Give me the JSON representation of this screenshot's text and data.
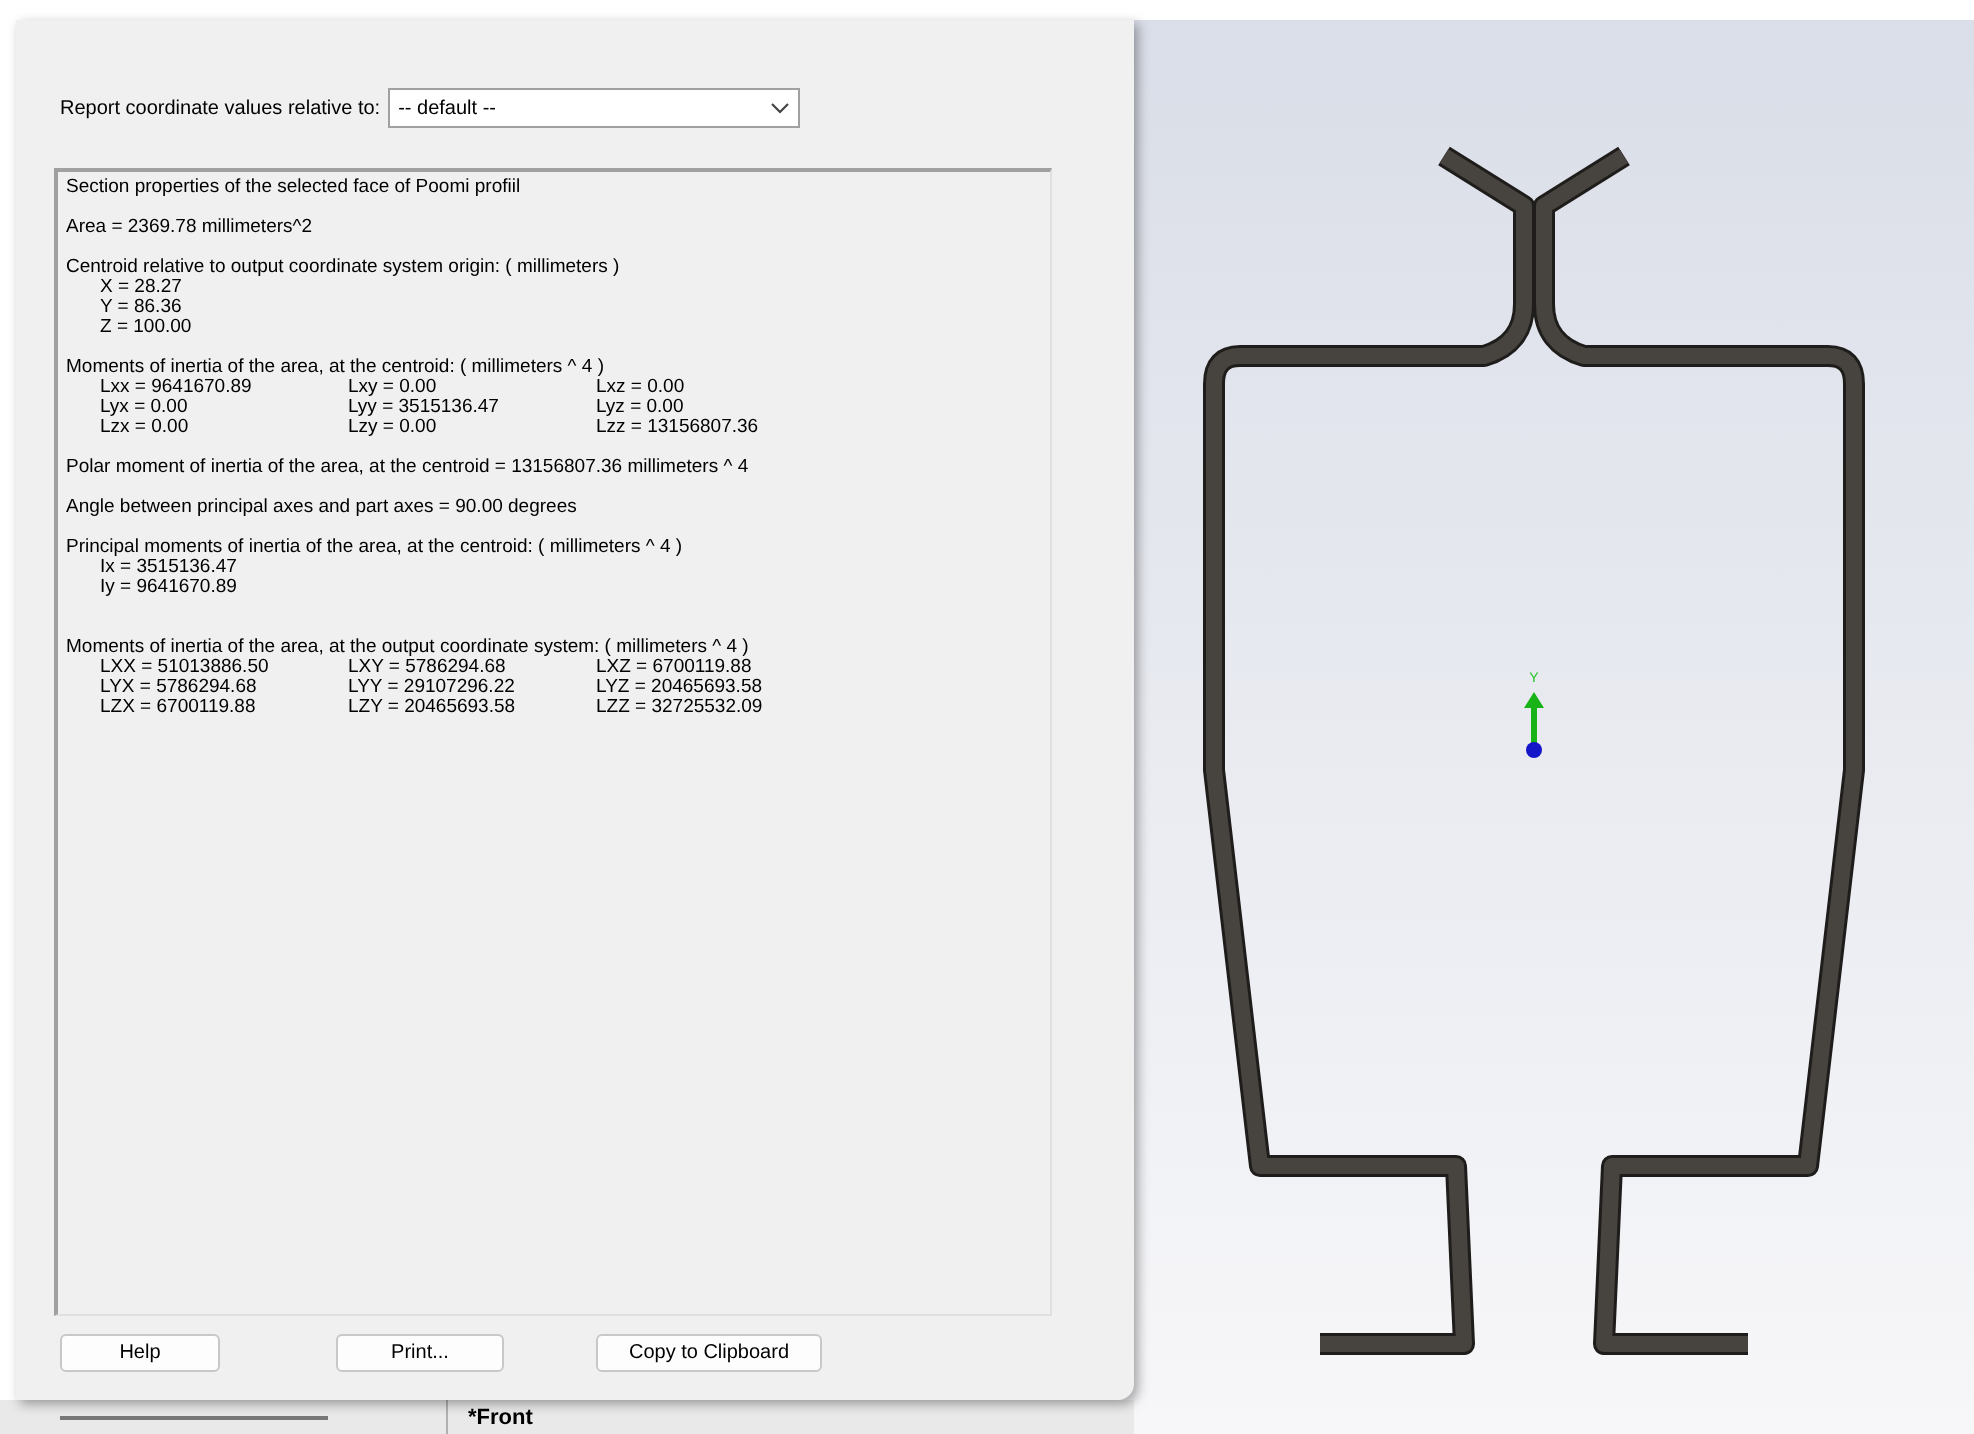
{
  "dialog": {
    "coordinate_label": "Report coordinate values relative to:",
    "coordinate_value": "-- default --",
    "report": [
      {
        "heading": "Section properties of the selected face of Poomi profiil"
      },
      {
        "heading": "Area = 2369.78 millimeters^2"
      },
      {
        "heading": "Centroid relative to output coordinate system origin: ( millimeters )",
        "rows": [
          [
            "X = 28.27"
          ],
          [
            "Y = 86.36"
          ],
          [
            "Z = 100.00"
          ]
        ]
      },
      {
        "heading": "Moments of inertia of the area, at the centroid: ( millimeters ^ 4 )",
        "rows": [
          [
            "Lxx = 9641670.89",
            "Lxy = 0.00",
            "Lxz = 0.00"
          ],
          [
            "Lyx = 0.00",
            "Lyy = 3515136.47",
            "Lyz = 0.00"
          ],
          [
            "Lzx = 0.00",
            "Lzy = 0.00",
            "Lzz = 13156807.36"
          ]
        ]
      },
      {
        "heading": "Polar moment of inertia of the area, at the centroid = 13156807.36 millimeters ^ 4"
      },
      {
        "heading": "Angle between principal axes and part axes = 90.00 degrees"
      },
      {
        "heading": "Principal moments of inertia of the area, at the centroid: ( millimeters ^ 4 )",
        "rows": [
          [
            "Ix = 3515136.47"
          ],
          [
            "Iy = 9641670.89"
          ]
        ]
      },
      {
        "heading": "Moments of inertia of the area, at the output coordinate system: ( millimeters ^ 4 )",
        "rows": [
          [
            "LXX = 51013886.50",
            "LXY = 5786294.68",
            "LXZ = 6700119.88"
          ],
          [
            "LYX = 5786294.68",
            "LYY = 29107296.22",
            "LYZ = 20465693.58"
          ],
          [
            "LZX = 6700119.88",
            "LZY = 20465693.58",
            "LZZ = 32725532.09"
          ]
        ]
      }
    ],
    "buttons": [
      "Help",
      "Print...",
      "Copy to Clipboard"
    ]
  },
  "viewport": {
    "triad_label": "Y",
    "view_name": "*Front"
  }
}
